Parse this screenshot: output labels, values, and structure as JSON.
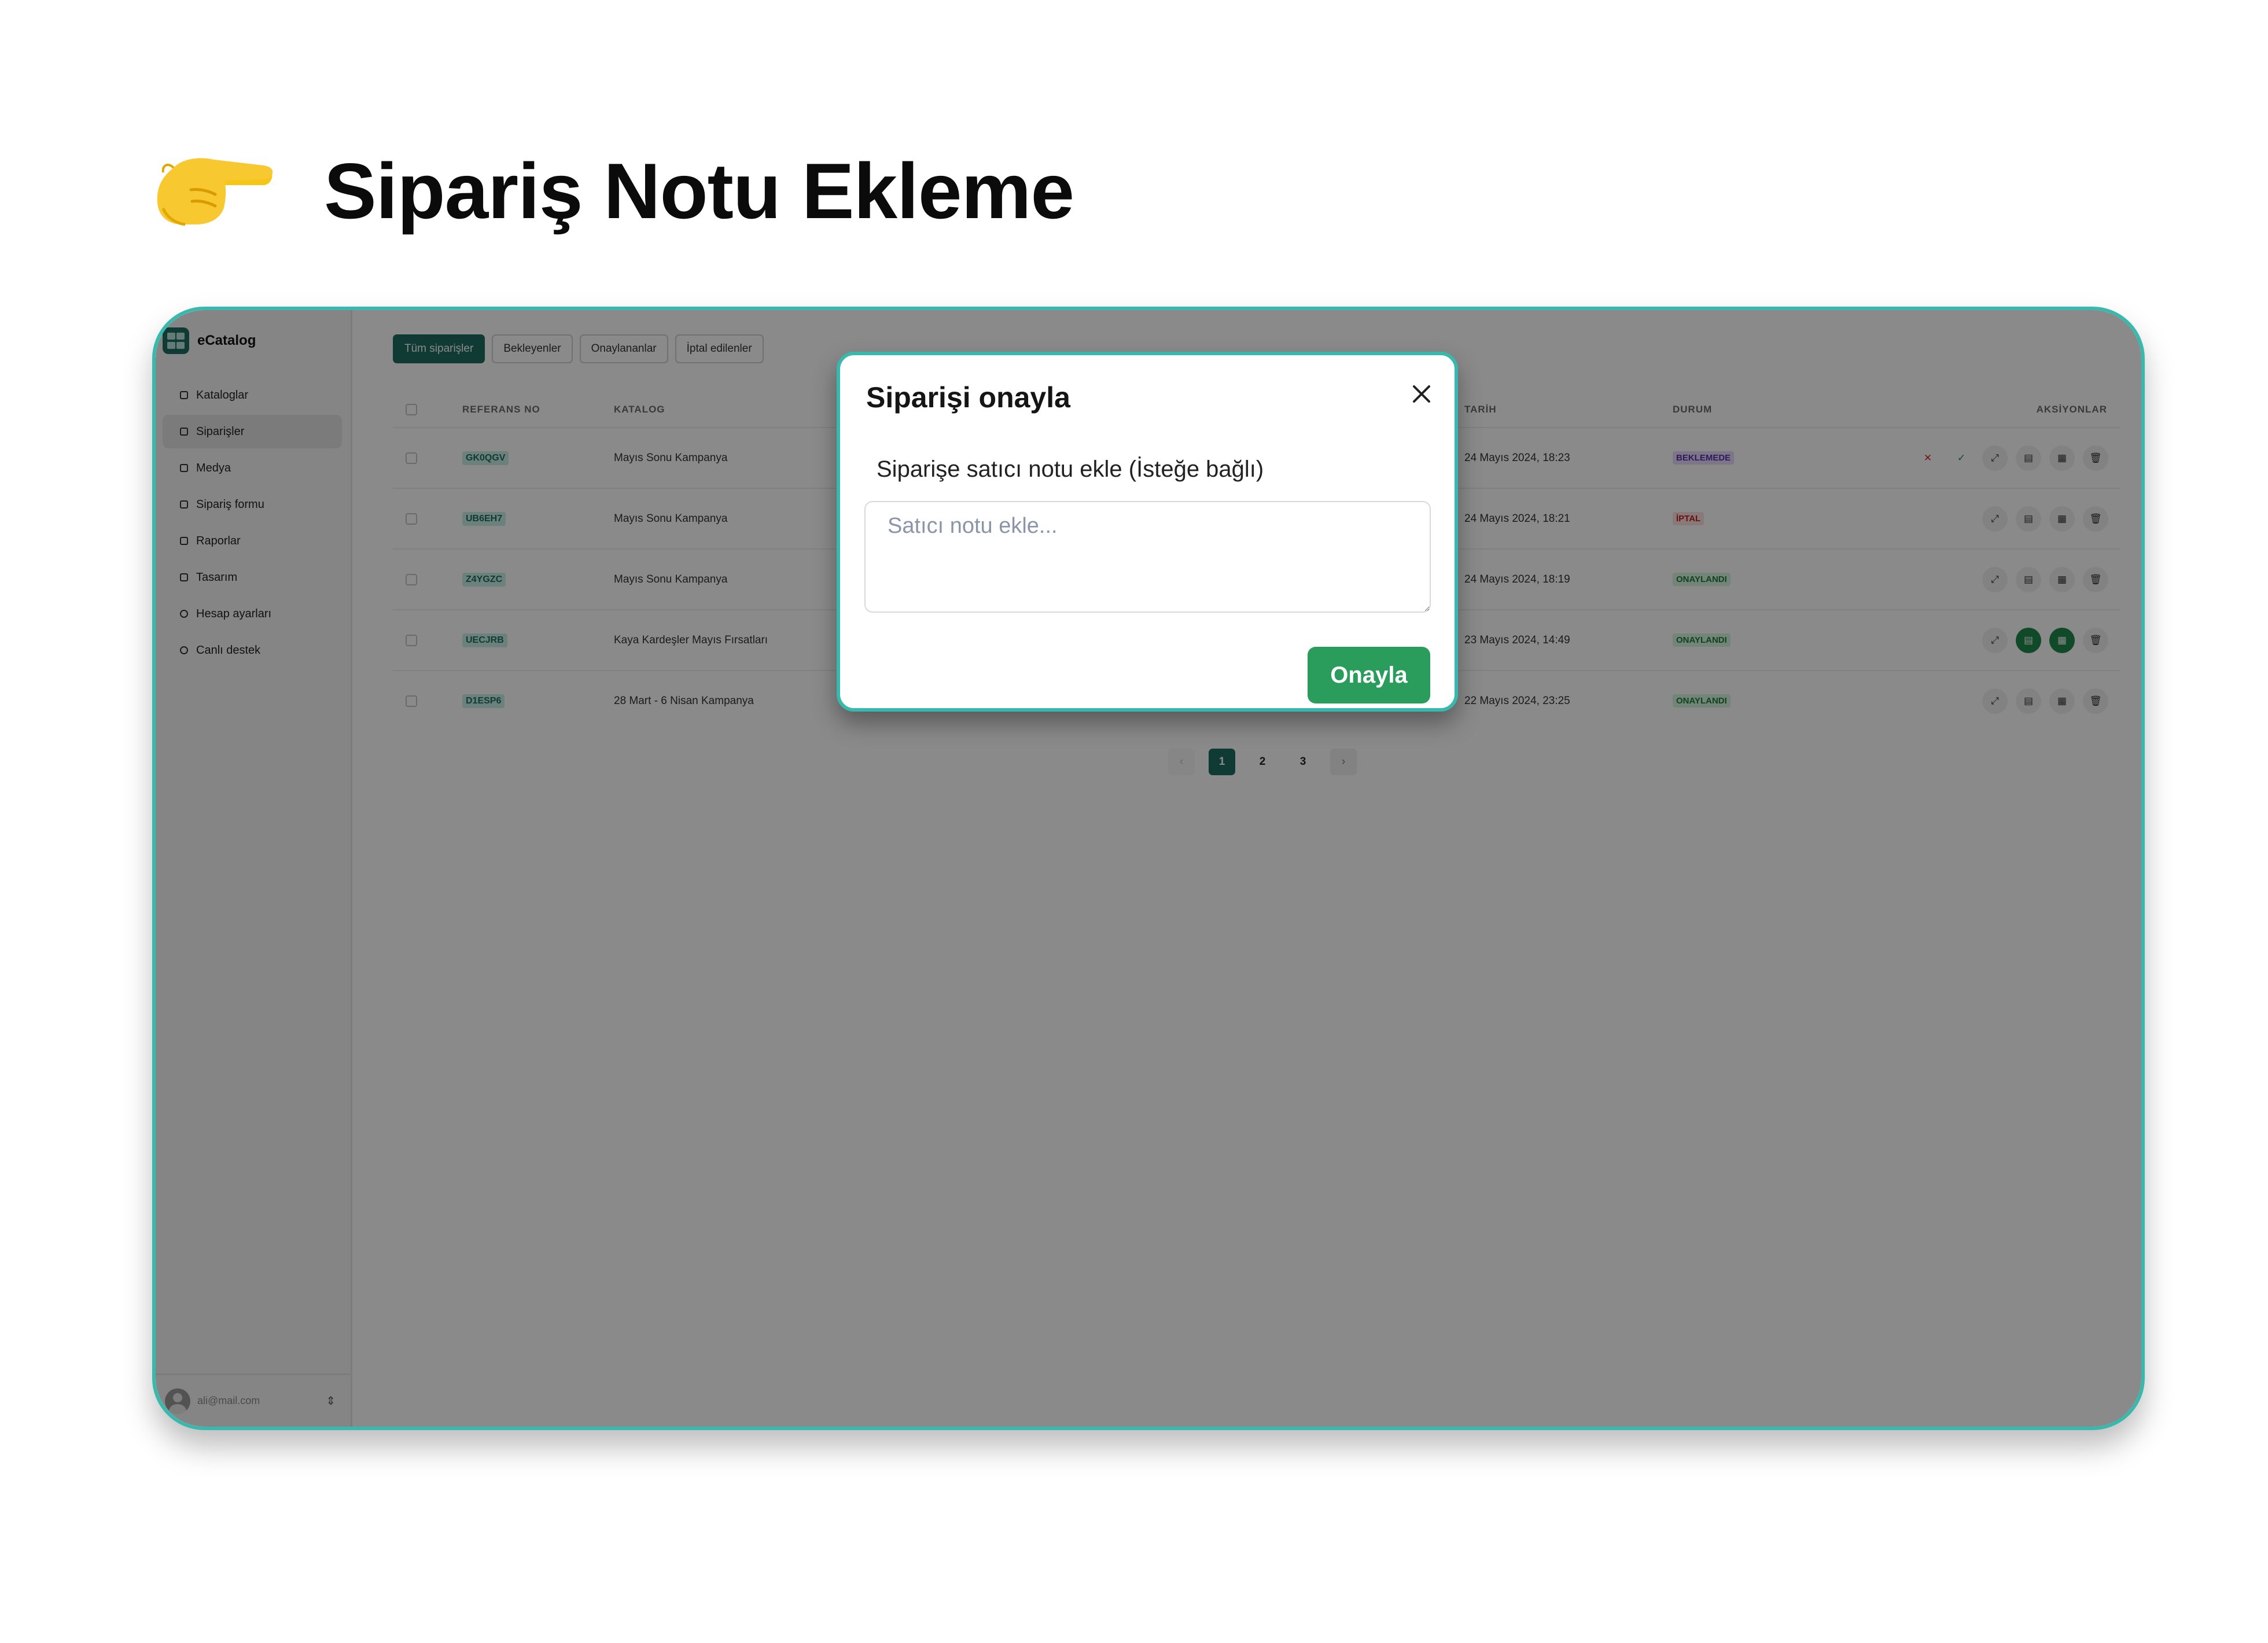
{
  "page": {
    "title": "Sipariş Notu Ekleme"
  },
  "app": {
    "brand": "eCatalog",
    "nav": [
      {
        "label": "Kataloglar"
      },
      {
        "label": "Siparişler"
      },
      {
        "label": "Medya"
      },
      {
        "label": "Sipariş formu"
      },
      {
        "label": "Raporlar"
      },
      {
        "label": "Tasarım"
      },
      {
        "label": "Hesap ayarları"
      },
      {
        "label": "Canlı destek"
      }
    ],
    "user_email": "ali@mail.com",
    "tabs": [
      "Tüm siparişler",
      "Bekleyenler",
      "Onaylananlar",
      "İptal edilenler"
    ],
    "table": {
      "headers": {
        "ref": "REFERANS NO",
        "catalog": "KATALOG",
        "date": "TARİH",
        "status": "DURUM",
        "actions": "AKSİYONLAR"
      },
      "rows": [
        {
          "ref": "GK0QGV",
          "catalog": "Mayıs Sonu Kampanya",
          "date": "24 Mayıs 2024, 18:23",
          "status": "BEKLEMEDE"
        },
        {
          "ref": "UB6EH7",
          "catalog": "Mayıs Sonu Kampanya",
          "date": "24 Mayıs 2024, 18:21",
          "status": "İPTAL"
        },
        {
          "ref": "Z4YGZC",
          "catalog": "Mayıs Sonu Kampanya",
          "date": "24 Mayıs 2024, 18:19",
          "status": "ONAYLANDI"
        },
        {
          "ref": "UECJRB",
          "catalog": "Kaya Kardeşler Mayıs Fırsatları",
          "date": "23 Mayıs 2024, 14:49",
          "status": "ONAYLANDI"
        },
        {
          "ref": "D1ESP6",
          "catalog": "28 Mart - 6 Nisan Kampanya",
          "date": "22 Mayıs 2024, 23:25",
          "status": "ONAYLANDI"
        }
      ]
    },
    "pagination": {
      "prev": "‹",
      "pages": [
        "1",
        "2",
        "3"
      ],
      "current": "1",
      "next": "›"
    }
  },
  "modal": {
    "title": "Siparişi onayla",
    "label": "Siparişe satıcı notu ekle (İsteğe bağlı)",
    "placeholder": "Satıcı notu ekle...",
    "value": "",
    "confirm": "Onayla"
  },
  "colors": {
    "accent": "#1f6d63",
    "frame_border": "#38b9ad",
    "confirm": "#2a9d5c"
  },
  "icons": [
    "pointing-hand-icon",
    "close-icon",
    "app-logo-icon",
    "edit-icon",
    "document-icon",
    "grid-icon",
    "trash-icon",
    "check-icon",
    "cancel-icon"
  ]
}
